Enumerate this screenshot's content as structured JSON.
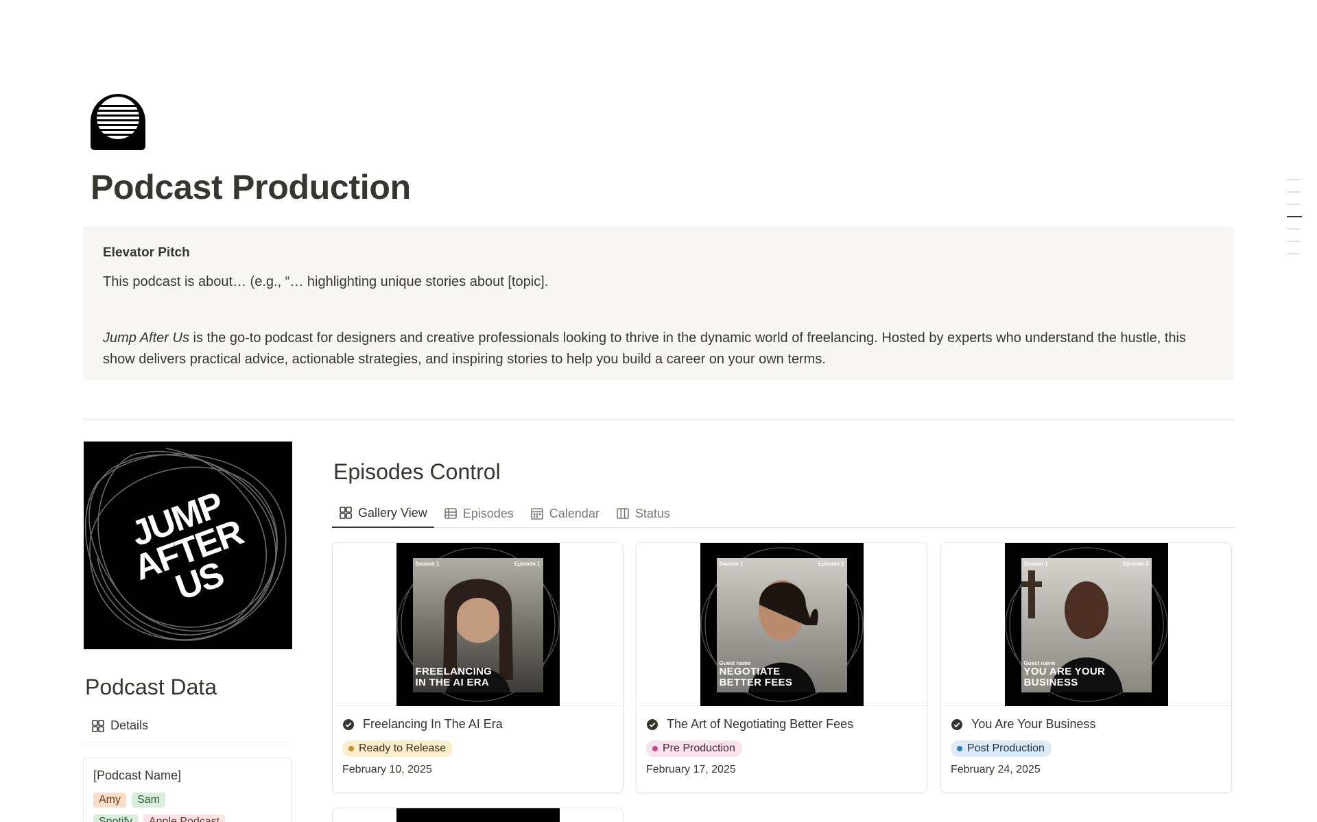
{
  "page": {
    "title": "Podcast Production",
    "icon": "radio-icon"
  },
  "callout": {
    "title": "Elevator Pitch",
    "line1": "This podcast is about… (e.g., “… highlighting unique stories about [topic].",
    "show_name": "Jump After Us",
    "line2": " is the go-to podcast for designers and creative professionals looking to thrive in the dynamic world of freelancing. Hosted by experts who understand the hustle, this show delivers practical advice, actionable strategies, and inspiring stories to help you build a career on your own terms."
  },
  "cover": {
    "logo_lines": [
      "JUMP",
      "AFTER",
      "US"
    ]
  },
  "podcast_data": {
    "title": "Podcast Data",
    "tab_label": "Details",
    "card": {
      "name": "[Podcast Name]",
      "hosts": [
        "Amy",
        "Sam"
      ],
      "platforms": [
        "Spotify",
        "Apple Podcast"
      ]
    }
  },
  "episodes": {
    "title": "Episodes Control",
    "tabs": [
      {
        "label": "Gallery View",
        "icon": "gallery-icon",
        "active": true
      },
      {
        "label": "Episodes",
        "icon": "table-icon",
        "active": false
      },
      {
        "label": "Calendar",
        "icon": "calendar-icon",
        "active": false
      },
      {
        "label": "Status",
        "icon": "board-icon",
        "active": false
      }
    ],
    "cards": [
      {
        "title": "Freelancing In The AI Era",
        "status": "Ready to Release",
        "status_color": "#cb912f",
        "status_bg": "#fbeecd",
        "date": "February 10, 2025",
        "art_season": "Season 1",
        "art_episode": "Episode 1",
        "art_guest": "",
        "art_line1": "FREELANCING",
        "art_line2": "IN THE AI ERA"
      },
      {
        "title": "The Art of Negotiating Better Fees",
        "status": "Pre Production",
        "status_color": "#c14c8a",
        "status_bg": "#f9e2ec",
        "date": "February 17, 2025",
        "art_season": "Season 1",
        "art_episode": "Episode 2",
        "art_guest": "Guest name",
        "art_line1": "NEGOTIATE",
        "art_line2": "BETTER FEES"
      },
      {
        "title": "You Are Your Business",
        "status": "Post Production",
        "status_color": "#337ea9",
        "status_bg": "#dbeaf6",
        "date": "February 24, 2025",
        "art_season": "Season 1",
        "art_episode": "Episode 3",
        "art_guest": "Guest name",
        "art_line1": "YOU ARE YOUR",
        "art_line2": "BUSINESS"
      }
    ]
  }
}
